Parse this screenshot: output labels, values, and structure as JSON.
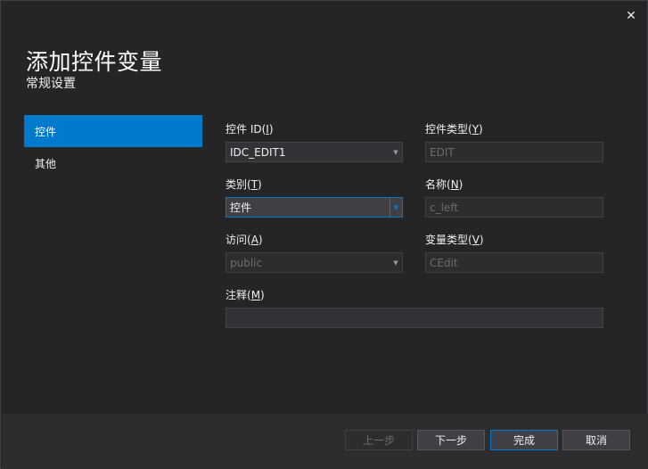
{
  "dialog": {
    "title": "添加控件变量",
    "subtitle": "常规设置",
    "close_glyph": "✕"
  },
  "nav": {
    "items": [
      {
        "label": "控件",
        "active": true
      },
      {
        "label": "其他",
        "active": false
      }
    ]
  },
  "form": {
    "control_id": {
      "label_text": "控件 ID(",
      "label_key": "I",
      "label_end": ")",
      "value": "IDC_EDIT1"
    },
    "control_type": {
      "label_text": "控件类型(",
      "label_key": "Y",
      "label_end": ")",
      "value": "EDIT"
    },
    "category": {
      "label_text": "类别(",
      "label_key": "T",
      "label_end": ")",
      "value": "控件"
    },
    "name": {
      "label_text": "名称(",
      "label_key": "N",
      "label_end": ")",
      "value": "c_left"
    },
    "access": {
      "label_text": "访问(",
      "label_key": "A",
      "label_end": ")",
      "value": "public"
    },
    "variable_type": {
      "label_text": "变量类型(",
      "label_key": "V",
      "label_end": ")",
      "value": "CEdit"
    },
    "comment": {
      "label_text": "注释(",
      "label_key": "M",
      "label_end": ")",
      "value": ""
    }
  },
  "footer": {
    "prev_label": "上一步",
    "next_label": "下一步",
    "finish_label": "完成",
    "cancel_label": "取消"
  },
  "colors": {
    "accent": "#007acc",
    "background": "#252526",
    "footer": "#2d2d30"
  }
}
